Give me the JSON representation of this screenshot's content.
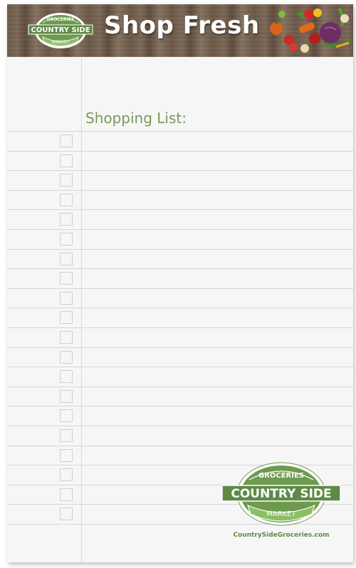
{
  "banner": {
    "title": "Shop Fresh",
    "logo": {
      "top": "GROCERIES",
      "middle": "COUNTRY SIDE",
      "bottom": "MARKET"
    }
  },
  "list": {
    "heading": "Shopping List:",
    "rows": 20
  },
  "footer": {
    "logo": {
      "top": "GROCERIES",
      "middle": "COUNTRY SIDE",
      "bottom": "MARKET"
    },
    "website": "CountrySideGroceries.com"
  },
  "colors": {
    "brand_green": "#5d8a45",
    "heading_green": "#7a9a5a",
    "wood": "#6d5a49"
  },
  "icons": [
    "vegetables-illustration",
    "checkbox"
  ]
}
